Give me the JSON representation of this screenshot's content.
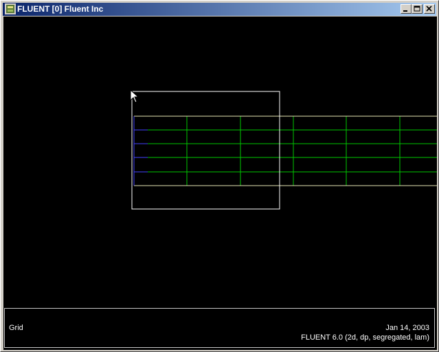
{
  "window": {
    "title": "FLUENT [0] Fluent Inc",
    "icon": "fluent-app-icon",
    "controls": [
      "minimize-icon",
      "maximize-icon",
      "close-icon"
    ]
  },
  "display": {
    "background": "#000000",
    "mesh_colors": {
      "interior": "#00c800",
      "wall_top": "#e6e6b4",
      "wall_bottom": "#e6e6b4",
      "inlet": "#4444ff",
      "zoom_box": "#ffffff"
    }
  },
  "info_panel": {
    "label": "Grid",
    "date": "Jan 14, 2003",
    "version": "FLUENT 6.0 (2d, dp, segregated, lam)"
  }
}
